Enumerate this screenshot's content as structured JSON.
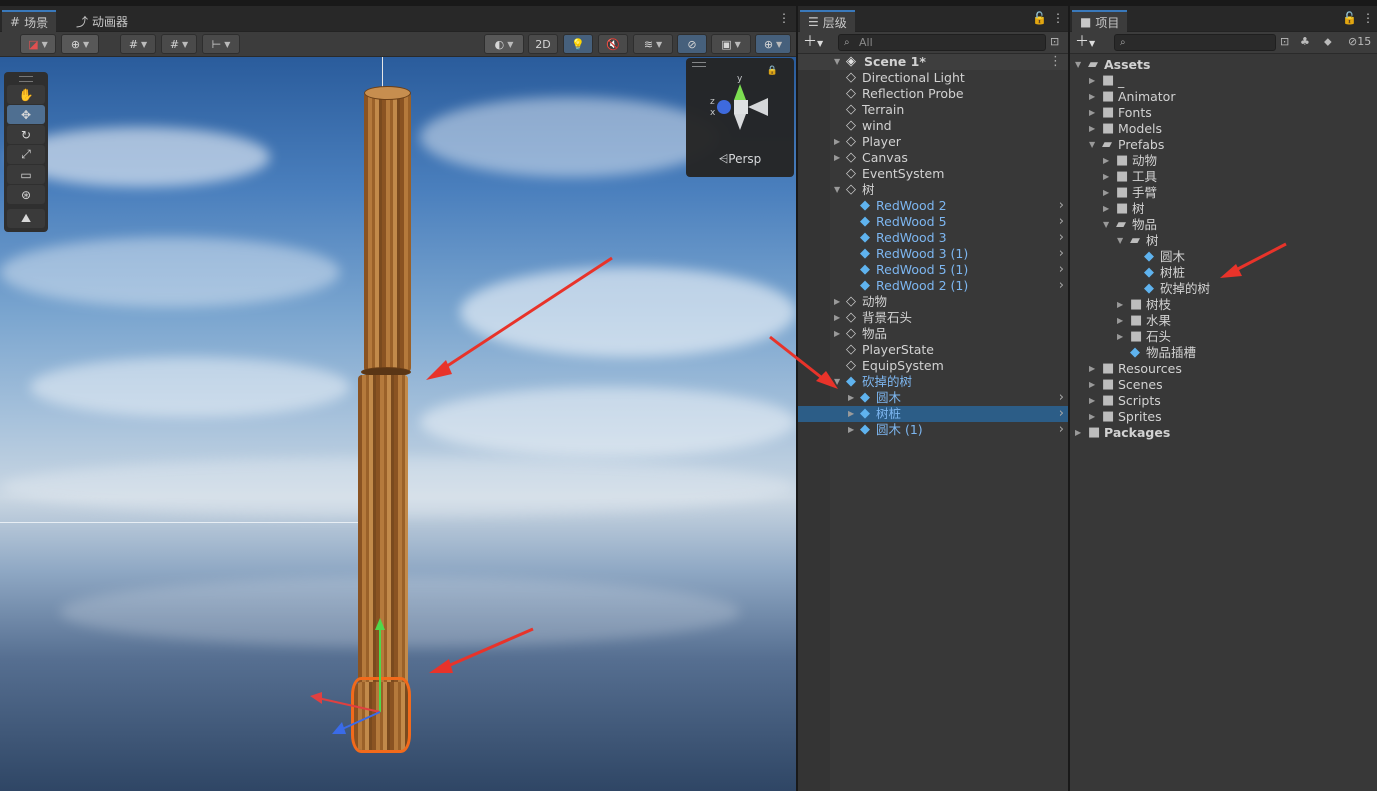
{
  "scene_panel": {
    "tabs": [
      {
        "label": "场景",
        "icon": "grid-icon"
      },
      {
        "label": "动画器",
        "icon": "animator-icon"
      }
    ],
    "toolbar": {
      "two_d_label": "2D"
    },
    "tools": [
      "hand-tool",
      "move-tool",
      "rotate-tool",
      "scale-tool",
      "rect-tool",
      "transform-tool",
      "custom-tool"
    ],
    "gizmo": {
      "label": "Persp",
      "axis_y": "y",
      "axis_z": "z",
      "axis_x": "x"
    }
  },
  "hierarchy": {
    "tab_label": "层级",
    "search_placeholder": "All",
    "scene_name": "Scene 1*",
    "items": [
      {
        "label": "Directional Light",
        "depth": 1,
        "type": "go",
        "expandable": false
      },
      {
        "label": "Reflection Probe",
        "depth": 1,
        "type": "go",
        "expandable": false
      },
      {
        "label": "Terrain",
        "depth": 1,
        "type": "go",
        "expandable": false
      },
      {
        "label": "wind",
        "depth": 1,
        "type": "go",
        "expandable": false
      },
      {
        "label": "Player",
        "depth": 1,
        "type": "go",
        "expandable": true
      },
      {
        "label": "Canvas",
        "depth": 1,
        "type": "go",
        "expandable": true
      },
      {
        "label": "EventSystem",
        "depth": 1,
        "type": "go",
        "expandable": false
      },
      {
        "label": "树",
        "depth": 1,
        "type": "go",
        "expandable": true,
        "expanded": true
      },
      {
        "label": "RedWood 2",
        "depth": 2,
        "type": "prefab",
        "chevron": true
      },
      {
        "label": "RedWood 5",
        "depth": 2,
        "type": "prefab",
        "chevron": true
      },
      {
        "label": "RedWood 3",
        "depth": 2,
        "type": "prefab",
        "chevron": true
      },
      {
        "label": "RedWood 3 (1)",
        "depth": 2,
        "type": "prefab",
        "chevron": true
      },
      {
        "label": "RedWood 5 (1)",
        "depth": 2,
        "type": "prefab",
        "chevron": true
      },
      {
        "label": "RedWood 2 (1)",
        "depth": 2,
        "type": "prefab",
        "chevron": true
      },
      {
        "label": "动物",
        "depth": 1,
        "type": "go",
        "expandable": true
      },
      {
        "label": "背景石头",
        "depth": 1,
        "type": "go",
        "expandable": true
      },
      {
        "label": "物品",
        "depth": 1,
        "type": "go",
        "expandable": true
      },
      {
        "label": "PlayerState",
        "depth": 1,
        "type": "go",
        "expandable": false
      },
      {
        "label": "EquipSystem",
        "depth": 1,
        "type": "go",
        "expandable": false
      },
      {
        "label": "砍掉的树",
        "depth": 1,
        "type": "prefab",
        "expandable": true,
        "expanded": true
      },
      {
        "label": "圆木",
        "depth": 2,
        "type": "prefab",
        "expandable": true,
        "chevron": true
      },
      {
        "label": "树桩",
        "depth": 2,
        "type": "prefab",
        "expandable": true,
        "chevron": true,
        "selected": true
      },
      {
        "label": "圆木 (1)",
        "depth": 2,
        "type": "prefab",
        "expandable": true,
        "chevron": true
      }
    ]
  },
  "project": {
    "tab_label": "项目",
    "badge_count": "15",
    "items": [
      {
        "label": "Assets",
        "depth": 0,
        "type": "folder",
        "expanded": true,
        "bold": true
      },
      {
        "label": "_",
        "depth": 1,
        "type": "folder",
        "expandable": true
      },
      {
        "label": "Animator",
        "depth": 1,
        "type": "folder",
        "expandable": true
      },
      {
        "label": "Fonts",
        "depth": 1,
        "type": "folder",
        "expandable": true
      },
      {
        "label": "Models",
        "depth": 1,
        "type": "folder",
        "expandable": true
      },
      {
        "label": "Prefabs",
        "depth": 1,
        "type": "folder",
        "expanded": true
      },
      {
        "label": "动物",
        "depth": 2,
        "type": "folder",
        "expandable": true
      },
      {
        "label": "工具",
        "depth": 2,
        "type": "folder",
        "expandable": true
      },
      {
        "label": "手臂",
        "depth": 2,
        "type": "folder",
        "expandable": true
      },
      {
        "label": "树",
        "depth": 2,
        "type": "folder",
        "expandable": true
      },
      {
        "label": "物品",
        "depth": 2,
        "type": "folder",
        "expanded": true
      },
      {
        "label": "树",
        "depth": 3,
        "type": "folder",
        "expanded": true
      },
      {
        "label": "圆木",
        "depth": 4,
        "type": "prefab"
      },
      {
        "label": "树桩",
        "depth": 4,
        "type": "prefab"
      },
      {
        "label": "砍掉的树",
        "depth": 4,
        "type": "prefab"
      },
      {
        "label": "树枝",
        "depth": 3,
        "type": "folder",
        "expandable": true
      },
      {
        "label": "水果",
        "depth": 3,
        "type": "folder",
        "expandable": true
      },
      {
        "label": "石头",
        "depth": 3,
        "type": "folder",
        "expandable": true
      },
      {
        "label": "物品插槽",
        "depth": 3,
        "type": "prefab"
      },
      {
        "label": "Resources",
        "depth": 1,
        "type": "folder",
        "expandable": true
      },
      {
        "label": "Scenes",
        "depth": 1,
        "type": "folder",
        "expandable": true
      },
      {
        "label": "Scripts",
        "depth": 1,
        "type": "folder",
        "expandable": true
      },
      {
        "label": "Sprites",
        "depth": 1,
        "type": "folder",
        "expandable": true
      },
      {
        "label": "Packages",
        "depth": 0,
        "type": "folder",
        "expandable": true,
        "bold": true
      }
    ]
  },
  "colors": {
    "selection": "#2c5d87",
    "prefab_text": "#7db6f0",
    "annotation_arrow": "#e8332a",
    "outline": "#f26a1b"
  }
}
